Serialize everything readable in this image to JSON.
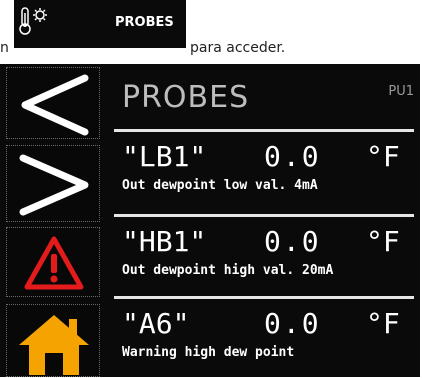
{
  "caption": {
    "prefix": "n",
    "button_label": "PROBES",
    "suffix": "para acceder."
  },
  "screen": {
    "title": "PROBES",
    "page_id": "PU1",
    "nav": {
      "prev_icon": "chevron-left-icon",
      "next_icon": "chevron-right-icon",
      "alarm_icon": "warning-icon",
      "home_icon": "home-icon"
    },
    "probes": [
      {
        "name": "\"LB1\"",
        "value": "0.0",
        "unit": "°F",
        "description": "Out dewpoint low val. 4mA"
      },
      {
        "name": "\"HB1\"",
        "value": "0.0",
        "unit": "°F",
        "description": "Out dewpoint high val. 20mA"
      },
      {
        "name": "\"A6\"",
        "value": "0.0",
        "unit": "°F",
        "description": "Warning high dew point"
      }
    ],
    "colors": {
      "background": "#0a0a0a",
      "alarm": "#e31b1b",
      "home": "#f5a300",
      "text": "#ffffff",
      "title": "#bdbdbd"
    }
  }
}
